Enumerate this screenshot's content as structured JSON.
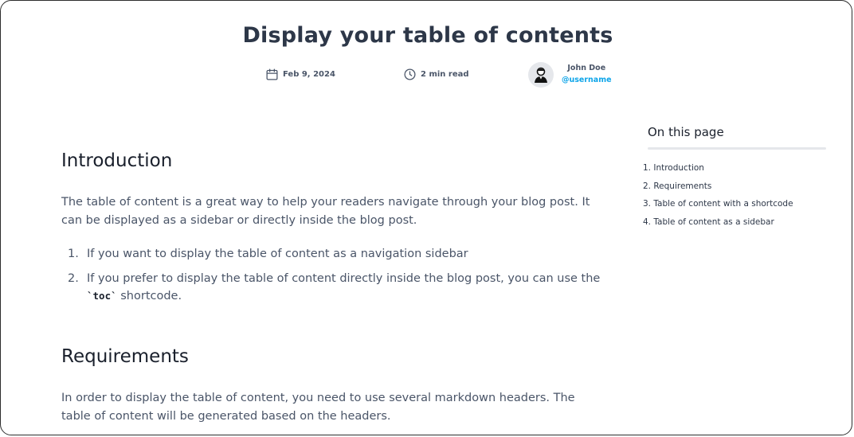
{
  "page": {
    "title": "Display your table of contents",
    "meta": {
      "date": "Feb 9, 2024",
      "read_time": "2 min read",
      "author_name": "John Doe",
      "author_handle": "@username"
    }
  },
  "article": {
    "intro_heading": "Introduction",
    "intro_paragraph": "The table of content is a great way to help your readers navigate through your blog post. It can be displayed as a sidebar or directly inside the blog post.",
    "list": [
      {
        "num": "1.",
        "text": "If you want to display the table of content as a navigation sidebar"
      },
      {
        "num": "2.",
        "text_before": "If you prefer to display the table of content directly inside the blog post, you can use the",
        "code": "`toc`",
        "text_after": " shortcode."
      }
    ],
    "req_heading": "Requirements",
    "req_paragraph": "In order to display the table of content, you need to use several markdown headers. The table of content will be generated based on the headers."
  },
  "toc": {
    "title": "On this page",
    "items": [
      "1. Introduction",
      "2. Requirements",
      "3. Table of content with a shortcode",
      "4. Table of content as a sidebar"
    ]
  },
  "icons": {
    "date": "calendar-icon",
    "read": "clock-icon",
    "avatar": "user-avatar-icon"
  },
  "colors": {
    "title": "#2d3748",
    "accent_handle": "#0ea5e9",
    "body_text": "#4a5568"
  }
}
